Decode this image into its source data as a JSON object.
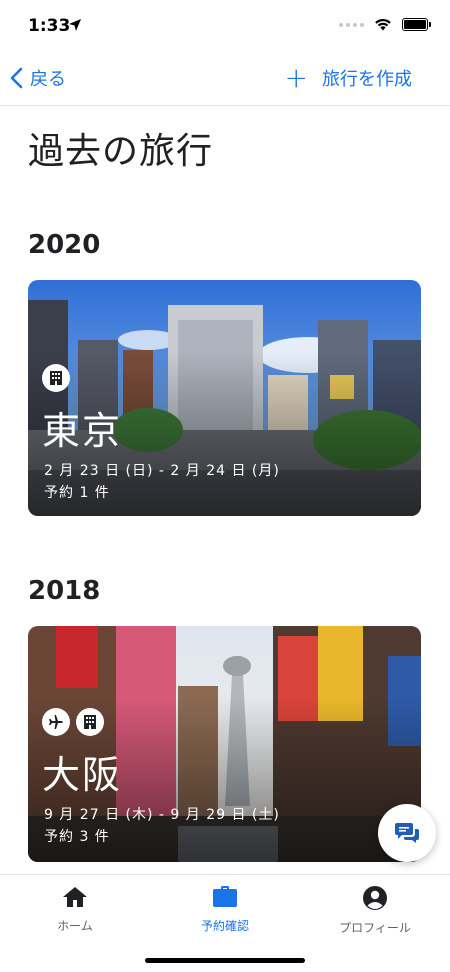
{
  "status_bar": {
    "time": "1:33"
  },
  "nav": {
    "back_label": "戻る",
    "create_label": "旅行を作成"
  },
  "page": {
    "title": "過去の旅行"
  },
  "sections": [
    {
      "year": "2020",
      "trip": {
        "city": "東京",
        "dates": "2 月 23 日 (日) - 2 月 24 日 (月)",
        "count": "予約 1 件",
        "icons": [
          "building-icon"
        ]
      }
    },
    {
      "year": "2018",
      "trip": {
        "city": "大阪",
        "dates": "9 月 27 日 (木) - 9 月 29 日 (土)",
        "count": "予約 3 件",
        "icons": [
          "airplane-icon",
          "building-icon"
        ]
      }
    }
  ],
  "tabs": [
    {
      "label": "ホーム",
      "icon": "home-icon",
      "active": false
    },
    {
      "label": "予約確認",
      "icon": "briefcase-icon",
      "active": true
    },
    {
      "label": "プロフィール",
      "icon": "account-icon",
      "active": false
    }
  ],
  "colors": {
    "accent": "#1a73e8",
    "text": "#202124",
    "inactive": "#5f6368"
  }
}
